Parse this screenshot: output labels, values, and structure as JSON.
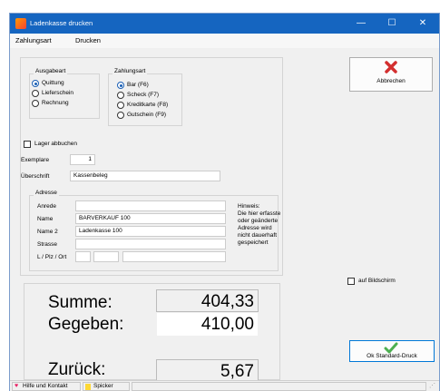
{
  "window": {
    "title": "Ladenkasse drucken",
    "minimize": "—",
    "maximize": "☐",
    "close": "✕"
  },
  "menu": [
    "Zahlungsart",
    "Drucken"
  ],
  "ausgabeart": {
    "legend": "Ausgabeart",
    "options": [
      "Quittung",
      "Lieferschein",
      "Rechnung"
    ],
    "selected": "Quittung"
  },
  "zahlungsart": {
    "legend": "Zahlungsart",
    "options": [
      "Bar (F6)",
      "Scheck (F7)",
      "Kreditkarte (F8)",
      "Gutschein (F9)"
    ],
    "selected": "Bar (F6)"
  },
  "lager": {
    "label": "Lager abbuchen",
    "checked": false
  },
  "exemplare": {
    "label": "Exemplare",
    "value": "1"
  },
  "ueberschrift": {
    "label": "Überschrift",
    "value": "Kassenbeleg"
  },
  "adresse": {
    "legend": "Adresse",
    "anrede": {
      "label": "Anrede",
      "value": ""
    },
    "name": {
      "label": "Name",
      "value": "BARVERKAUF 100"
    },
    "name2": {
      "label": "Name 2",
      "value": "Ladenkasse 100"
    },
    "strasse": {
      "label": "Strasse",
      "value": ""
    },
    "ort": {
      "label": "L / Plz / Ort",
      "land": "",
      "plz": "",
      "ort": ""
    },
    "hinweis": "Hinweis:\nDie hier erfasste oder geänderte Adresse wird nicht dauerhaft gespeichert"
  },
  "buttons": {
    "abbrechen": "Abbrechen",
    "ok": "Ok Standard-Druck"
  },
  "bildschirm": {
    "label": "auf Bildschirm",
    "checked": false
  },
  "summe": {
    "label": "Summe:",
    "value": "404,33"
  },
  "gegeben": {
    "label": "Gegeben:",
    "value": "410,00"
  },
  "zurueck": {
    "label": "Zurück:",
    "value": "5,67"
  },
  "status": {
    "hilfe": "Hilfe und Kontakt",
    "spicker": "Spicker"
  },
  "colors": {
    "titlebar": "#1565c0",
    "accent": "#1a5fb4",
    "cancel": "#d32f2f",
    "ok": "#4caf50"
  }
}
